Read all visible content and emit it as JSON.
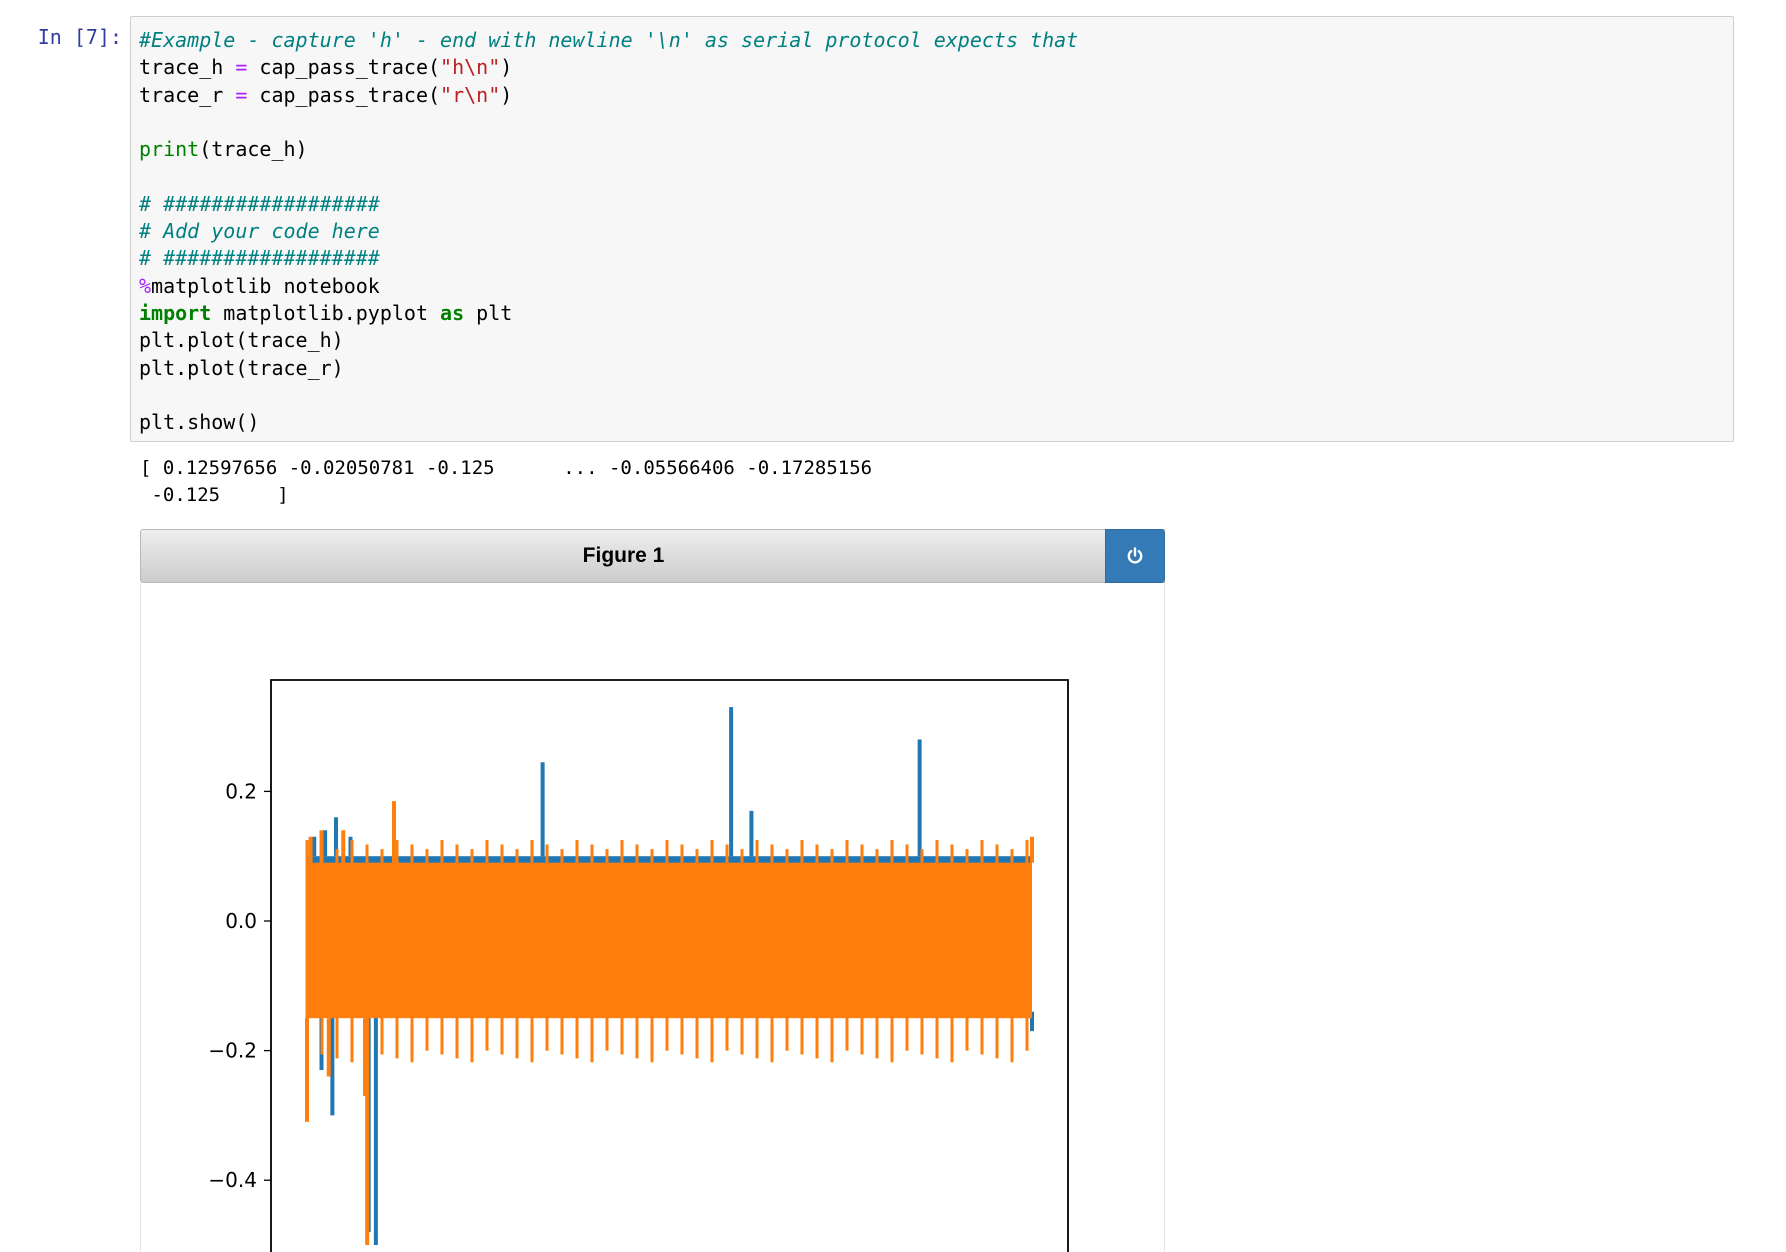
{
  "cell": {
    "prompt": "In [7]:",
    "code_lines": [
      [
        {
          "t": "#Example - capture 'h' - end with newline '\\n' as serial protocol expects that",
          "c": "comment"
        }
      ],
      [
        {
          "t": "trace_h ",
          "c": ""
        },
        {
          "t": "=",
          "c": "operator"
        },
        {
          "t": " cap_pass_trace(",
          "c": ""
        },
        {
          "t": "\"h\\n\"",
          "c": "string"
        },
        {
          "t": ")",
          "c": ""
        }
      ],
      [
        {
          "t": "trace_r ",
          "c": ""
        },
        {
          "t": "=",
          "c": "operator"
        },
        {
          "t": " cap_pass_trace(",
          "c": ""
        },
        {
          "t": "\"r\\n\"",
          "c": "string"
        },
        {
          "t": ")",
          "c": ""
        }
      ],
      [],
      [
        {
          "t": "print",
          "c": "builtin"
        },
        {
          "t": "(trace_h)",
          "c": ""
        }
      ],
      [],
      [
        {
          "t": "# ##################",
          "c": "comment"
        }
      ],
      [
        {
          "t": "# Add your code here",
          "c": "comment"
        }
      ],
      [
        {
          "t": "# ##################",
          "c": "comment"
        }
      ],
      [
        {
          "t": "%",
          "c": "magic"
        },
        {
          "t": "matplotlib notebook",
          "c": ""
        }
      ],
      [
        {
          "t": "import",
          "c": "keyword"
        },
        {
          "t": " matplotlib.pyplot ",
          "c": ""
        },
        {
          "t": "as",
          "c": "keyword"
        },
        {
          "t": " plt",
          "c": ""
        }
      ],
      [
        {
          "t": "plt.plot(trace_h)",
          "c": ""
        }
      ],
      [
        {
          "t": "plt.plot(trace_r)",
          "c": ""
        }
      ],
      [],
      [
        {
          "t": "plt.show()",
          "c": ""
        }
      ]
    ],
    "output": "[ 0.12597656 -0.02050781 -0.125      ... -0.05566406 -0.17285156\n -0.125     ]"
  },
  "figure": {
    "title": "Figure 1",
    "power_icon": "power-icon"
  },
  "chart_data": {
    "type": "line",
    "ylim": [
      -0.52,
      0.37
    ],
    "grid": false,
    "yticks": [
      {
        "value": 0.2,
        "label": "0.2"
      },
      {
        "value": 0.0,
        "label": "0.0"
      },
      {
        "value": -0.2,
        "label": "−0.2"
      },
      {
        "value": -0.4,
        "label": "−0.4"
      }
    ],
    "series": [
      {
        "color": "#1f77b4",
        "period": 15,
        "base_high": 0.12,
        "base_low": -0.19,
        "fill_high": 0.1,
        "fill_low": -0.14,
        "spikes": [
          {
            "at": 0.01,
            "value": 0.13
          },
          {
            "at": 0.025,
            "value": 0.14
          },
          {
            "at": 0.04,
            "value": 0.16
          },
          {
            "at": 0.06,
            "value": 0.13
          },
          {
            "at": 0.02,
            "value": -0.23
          },
          {
            "at": 0.035,
            "value": -0.3
          },
          {
            "at": 0.095,
            "value": -0.5
          },
          {
            "at": 0.085,
            "value": -0.48
          },
          {
            "at": 0.325,
            "value": 0.245
          },
          {
            "at": 0.585,
            "value": 0.33
          },
          {
            "at": 0.613,
            "value": 0.17
          },
          {
            "at": 0.845,
            "value": 0.28
          },
          {
            "at": 1.0,
            "value": -0.17
          }
        ]
      },
      {
        "color": "#ff7f0e",
        "period": 15,
        "base_high": 0.125,
        "base_low": -0.2,
        "fill_high": 0.09,
        "fill_low": -0.15,
        "spikes": [
          {
            "at": 0.0,
            "value": -0.31
          },
          {
            "at": 0.005,
            "value": 0.13
          },
          {
            "at": 0.02,
            "value": 0.14
          },
          {
            "at": 0.03,
            "value": -0.24
          },
          {
            "at": 0.05,
            "value": 0.14
          },
          {
            "at": 0.08,
            "value": -0.27
          },
          {
            "at": 0.083,
            "value": -0.5
          },
          {
            "at": 0.12,
            "value": 0.185
          },
          {
            "at": 1.0,
            "value": 0.13
          }
        ]
      }
    ]
  }
}
